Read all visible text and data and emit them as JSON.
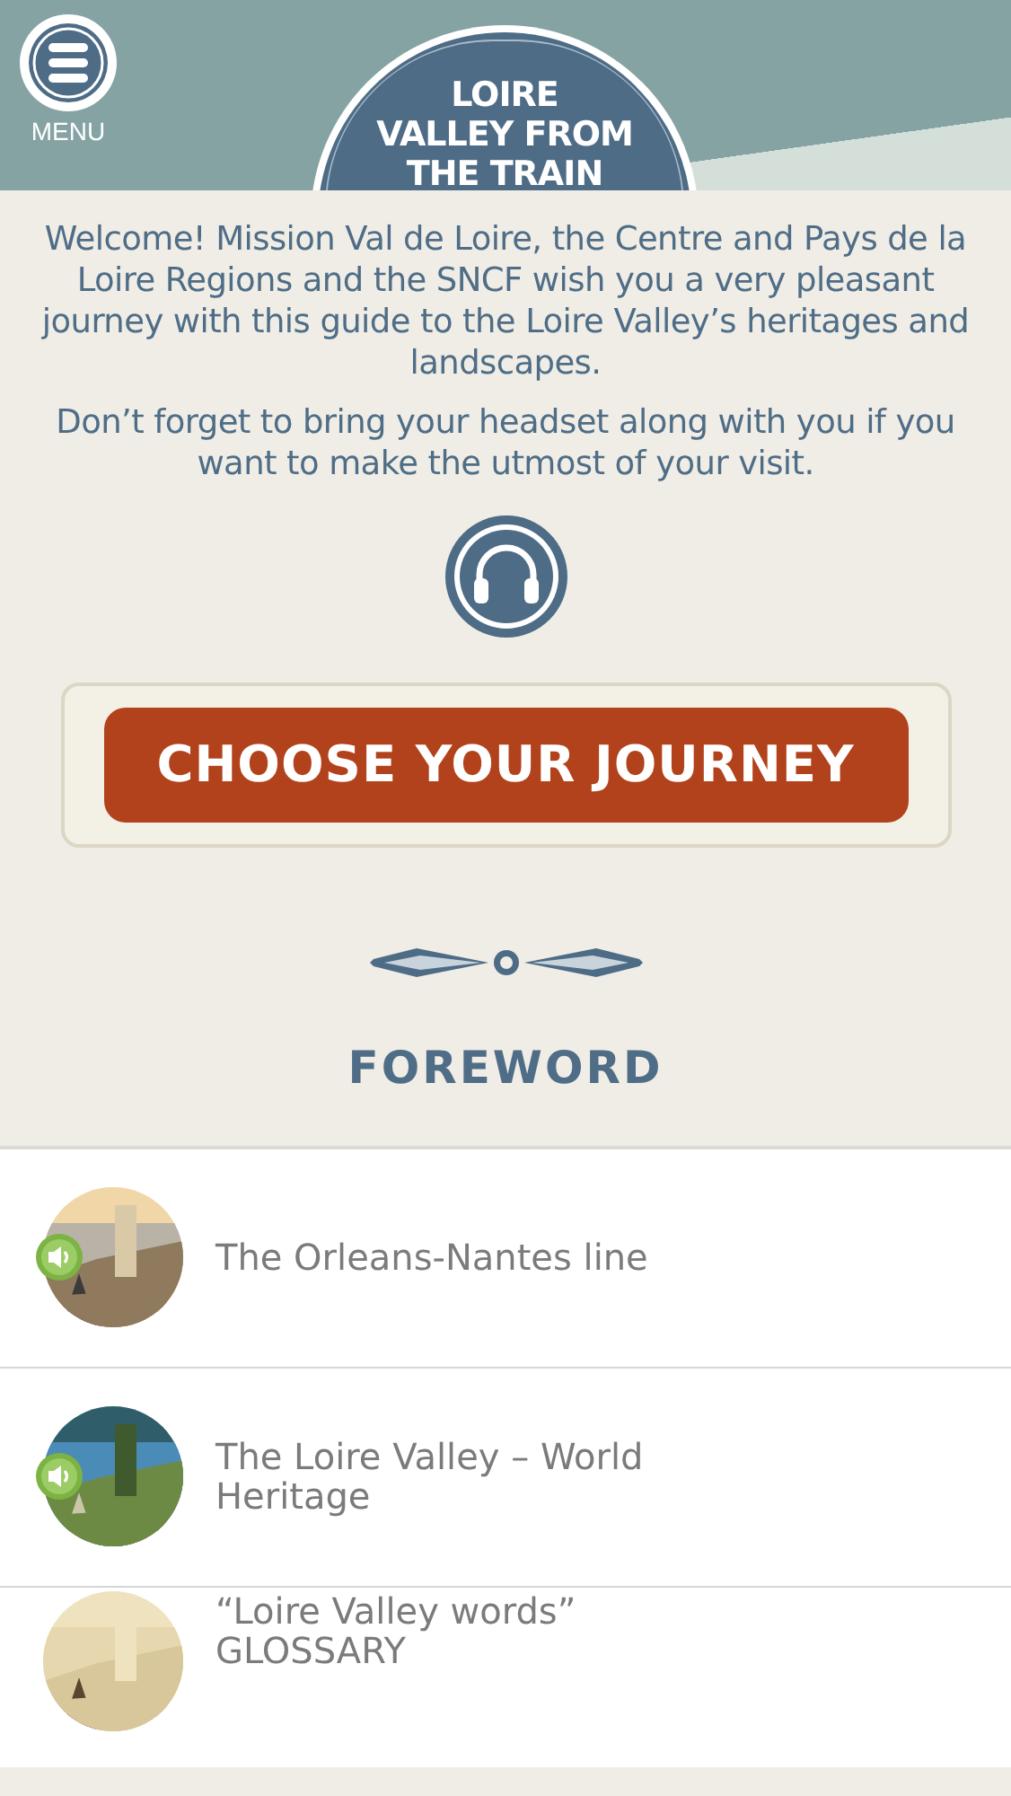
{
  "header": {
    "menu_label": "MENU",
    "title_lines": [
      "LOIRE",
      "VALLEY FROM",
      "THE TRAIN"
    ]
  },
  "intro": [
    "Welcome! Mission Val de Loire, the Centre and Pays de la Loire Regions and the SNCF wish you a very pleasant journey with this guide to the Loire Valley’s heritages and landscapes.",
    "Don’t forget to bring your headset along with you if you want to make the utmost of your visit."
  ],
  "cta": {
    "label": "CHOOSE YOUR JOURNEY"
  },
  "section_title": "FOREWORD",
  "items": [
    {
      "lines": [
        "The Orleans-Nantes line"
      ],
      "audio": true
    },
    {
      "lines": [
        "The Loire Valley – World",
        "Heritage"
      ],
      "audio": true
    },
    {
      "lines": [
        "“Loire Valley words”",
        "GLOSSARY"
      ],
      "audio": false
    }
  ]
}
